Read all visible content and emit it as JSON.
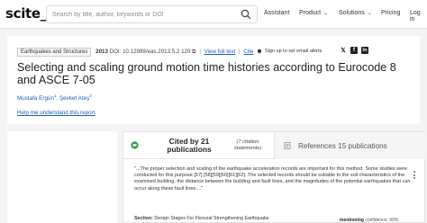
{
  "brand": {
    "logo_text": "scite_"
  },
  "search": {
    "placeholder": "Search by title, author, keywords or DOI"
  },
  "nav": {
    "assistant": "Assistant",
    "product": "Product",
    "solutions": "Solutions",
    "pricing": "Pricing",
    "login": "Log in"
  },
  "paper": {
    "topic_tag": "Earthquakes and Structures",
    "year": "2013",
    "doi": "DOI: 10.12989/eas.2013.5.2.129",
    "view_full_text": "View full text",
    "cite": "Cite",
    "signup_alerts": "Sign up to set email alerts",
    "title": "Selecting and scaling ground motion time histories according to Eurocode 8 and ASCE 7-05",
    "authors": [
      {
        "name": "Mustafa Ergün",
        "sup": "1"
      },
      {
        "name": "Şevket Ateş",
        "sup": "2"
      }
    ],
    "help_link": "Help me understand this report"
  },
  "tabs": {
    "cited_by": "Cited by 21 publications",
    "cited_sub": "(7 citation statements)",
    "references": "References 15 publications"
  },
  "citation": {
    "text_before": "\"...The proper selection and scaling of the earthquake acceleration records are important for this method. Some studies were conducted for this purpose ",
    "refs": "[57] [58][59][60][61][62]",
    "text_after": ". The selected records should be suitable to the soil characteristics of the examined building, the distance between the building and fault lines, and the magnitudes of the potential earthquakes that can occur along these fault lines....\"",
    "section_label": "Section:",
    "section_value": "Design Stages For Flexural Strengthening Earthquake",
    "mention_label": "mentioning",
    "confidence": "confidence: 99%"
  },
  "colors": {
    "link": "#1a5fb4",
    "badge_green": "#2e9e4f"
  }
}
